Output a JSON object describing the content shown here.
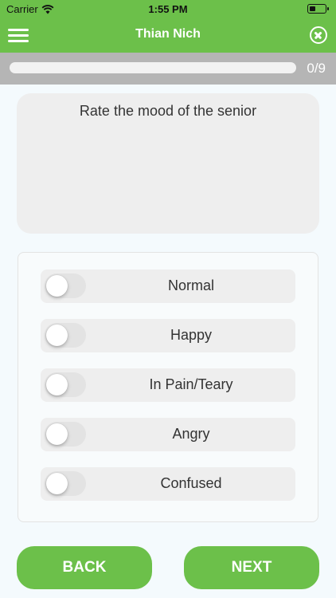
{
  "status_bar": {
    "carrier": "Carrier",
    "time": "1:55 PM",
    "battery_level": 0.4
  },
  "nav": {
    "title": "Thian Nich",
    "menu_icon": "hamburger-menu-icon",
    "close_icon": "close-circle-icon"
  },
  "progress": {
    "text": "0/9",
    "current": 0,
    "total": 9
  },
  "question": {
    "text": "Rate the mood of the senior"
  },
  "options": [
    {
      "label": "Normal",
      "checked": false
    },
    {
      "label": "Happy",
      "checked": false
    },
    {
      "label": "In Pain/Teary",
      "checked": false
    },
    {
      "label": "Angry",
      "checked": false
    },
    {
      "label": "Confused",
      "checked": false
    }
  ],
  "buttons": {
    "back_label": "BACK",
    "next_label": "NEXT"
  },
  "colors": {
    "accent": "#6cc04a",
    "progress_strip": "#b5b5b5",
    "card": "#eeeeee"
  }
}
